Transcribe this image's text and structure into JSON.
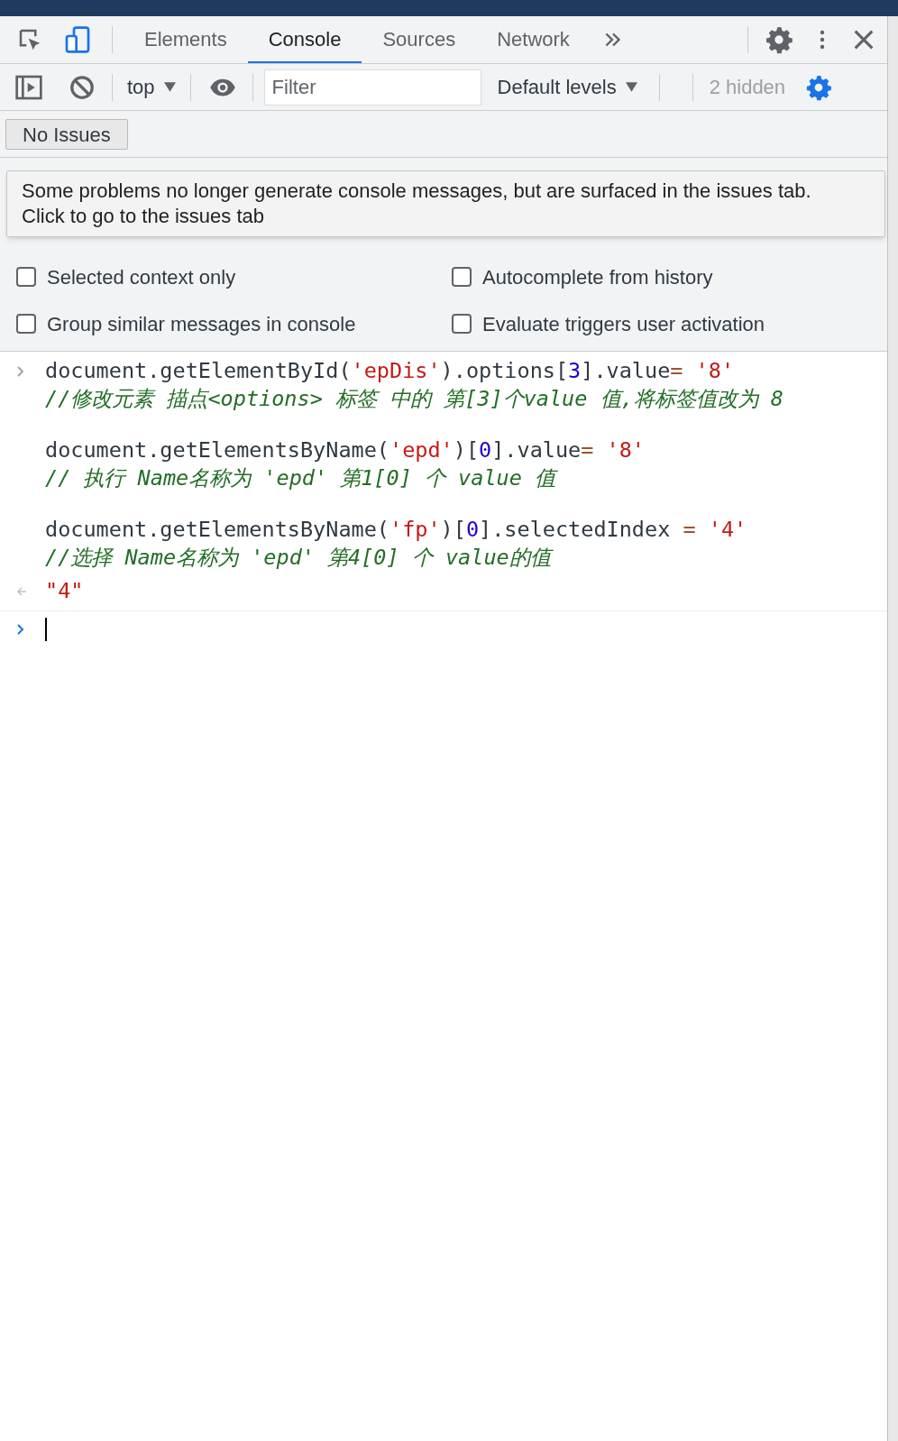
{
  "tabs": [
    {
      "label": "Elements",
      "selected": false
    },
    {
      "label": "Console",
      "selected": true
    },
    {
      "label": "Sources",
      "selected": false
    },
    {
      "label": "Network",
      "selected": false
    }
  ],
  "toolbar": {
    "context": "top",
    "filter": {
      "placeholder": "Filter"
    },
    "levels": "Default levels",
    "hidden_count": "2 hidden"
  },
  "issues_button": "No Issues",
  "tooltip": "Some problems no longer generate console messages, but are surfaced in the issues tab. Click to go to the issues tab",
  "settings": [
    {
      "label": "Selected context only",
      "checked": false
    },
    {
      "label": "Autocomplete from history",
      "checked": false
    },
    {
      "label": "Group similar messages in console",
      "checked": false
    },
    {
      "label": "Evaluate triggers user activation",
      "checked": false
    }
  ],
  "console": {
    "statements": [
      {
        "code": [
          {
            "kind": "text",
            "text": "document.getElementById("
          },
          {
            "kind": "string",
            "text": "'epDis'"
          },
          {
            "kind": "text",
            "text": ").options["
          },
          {
            "kind": "number",
            "text": "3"
          },
          {
            "kind": "text",
            "text": "].value"
          },
          {
            "kind": "operator",
            "text": "="
          },
          {
            "kind": "string",
            "text": " '8'"
          }
        ],
        "comment": "//修改元素 描点<options> 标签 中的 第[3]个value 值,将标签值改为 8"
      },
      {
        "code": [
          {
            "kind": "text",
            "text": "document.getElementsByName("
          },
          {
            "kind": "string",
            "text": "'epd'"
          },
          {
            "kind": "text",
            "text": ")["
          },
          {
            "kind": "number",
            "text": "0"
          },
          {
            "kind": "text",
            "text": "].value"
          },
          {
            "kind": "operator",
            "text": "="
          },
          {
            "kind": "string",
            "text": " '8'"
          }
        ],
        "comment": "// 执行 Name名称为 'epd' 第1[0] 个 value 值"
      },
      {
        "code": [
          {
            "kind": "text",
            "text": "document.getElementsByName("
          },
          {
            "kind": "string",
            "text": "'fp'"
          },
          {
            "kind": "text",
            "text": ")["
          },
          {
            "kind": "number",
            "text": "0"
          },
          {
            "kind": "text",
            "text": "].selectedIndex "
          },
          {
            "kind": "operator",
            "text": "="
          },
          {
            "kind": "string",
            "text": " '4'"
          }
        ],
        "comment": "//选择 Name名称为 'epd' 第4[0] 个 value的值"
      }
    ],
    "result": "\"4\""
  }
}
